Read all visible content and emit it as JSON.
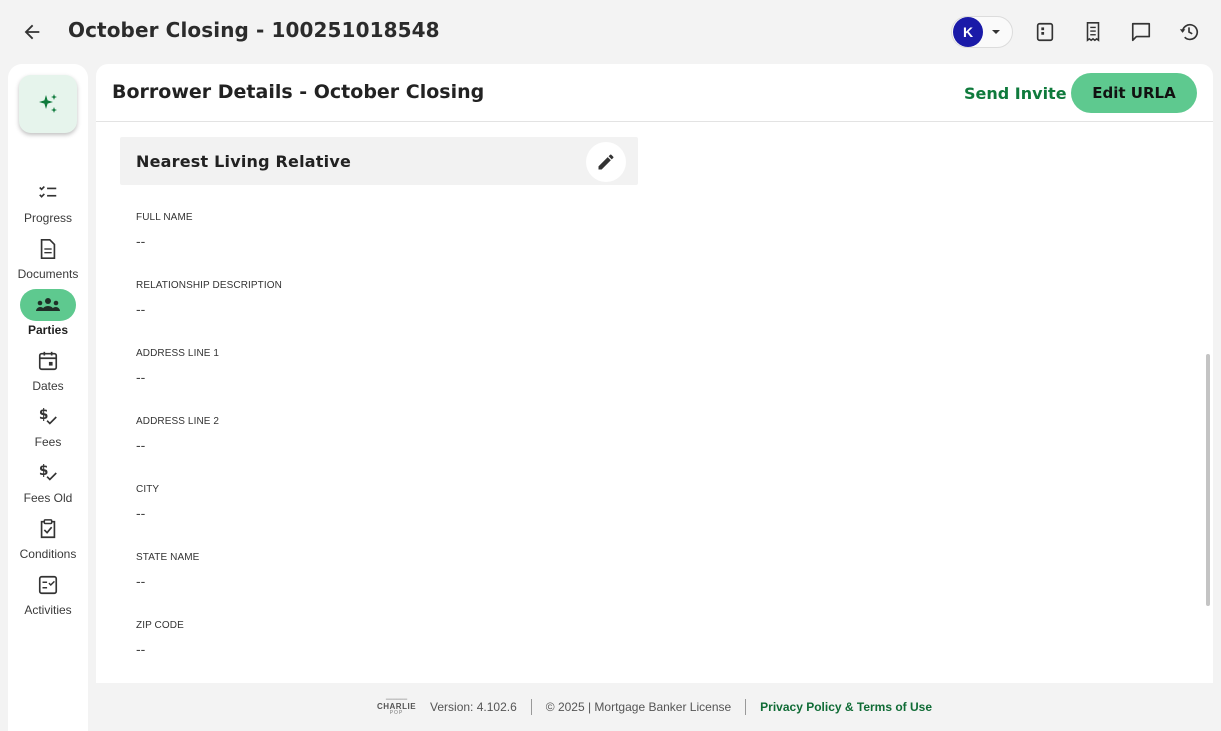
{
  "header": {
    "title": "October Closing - 100251018548",
    "user_initial": "K"
  },
  "sidebar": {
    "items": [
      {
        "label": "Progress",
        "icon": "checklist-icon"
      },
      {
        "label": "Documents",
        "icon": "document-icon"
      },
      {
        "label": "Parties",
        "icon": "groups-icon",
        "active": true
      },
      {
        "label": "Dates",
        "icon": "calendar-icon"
      },
      {
        "label": "Fees",
        "icon": "dollar-check-icon"
      },
      {
        "label": "Fees Old",
        "icon": "dollar-check-icon"
      },
      {
        "label": "Conditions",
        "icon": "clipboard-check-icon"
      },
      {
        "label": "Activities",
        "icon": "checkbox-list-icon"
      }
    ]
  },
  "main": {
    "title": "Borrower Details - October Closing",
    "send_invite": "Send Invite",
    "edit_urla": "Edit URLA",
    "section_title": "Nearest Living Relative",
    "fields": [
      {
        "label": "FULL NAME",
        "value": "--"
      },
      {
        "label": "RELATIONSHIP DESCRIPTION",
        "value": "--"
      },
      {
        "label": "ADDRESS LINE 1",
        "value": "--"
      },
      {
        "label": "ADDRESS LINE 2",
        "value": "--"
      },
      {
        "label": "CITY",
        "value": "--"
      },
      {
        "label": "STATE NAME",
        "value": "--"
      },
      {
        "label": "ZIP CODE",
        "value": "--"
      }
    ]
  },
  "footer": {
    "logo_top": "══════",
    "logo_mid": "CHARLIE",
    "logo_bot": "POP",
    "version": "Version: 4.102.6",
    "copyright": "© 2025 | Mortgage Banker License",
    "privacy": "Privacy Policy & Terms of Use"
  },
  "colors": {
    "accent_green": "#5ec98f",
    "link_green": "#0f7a3c",
    "avatar_blue": "#1a1aa8"
  }
}
